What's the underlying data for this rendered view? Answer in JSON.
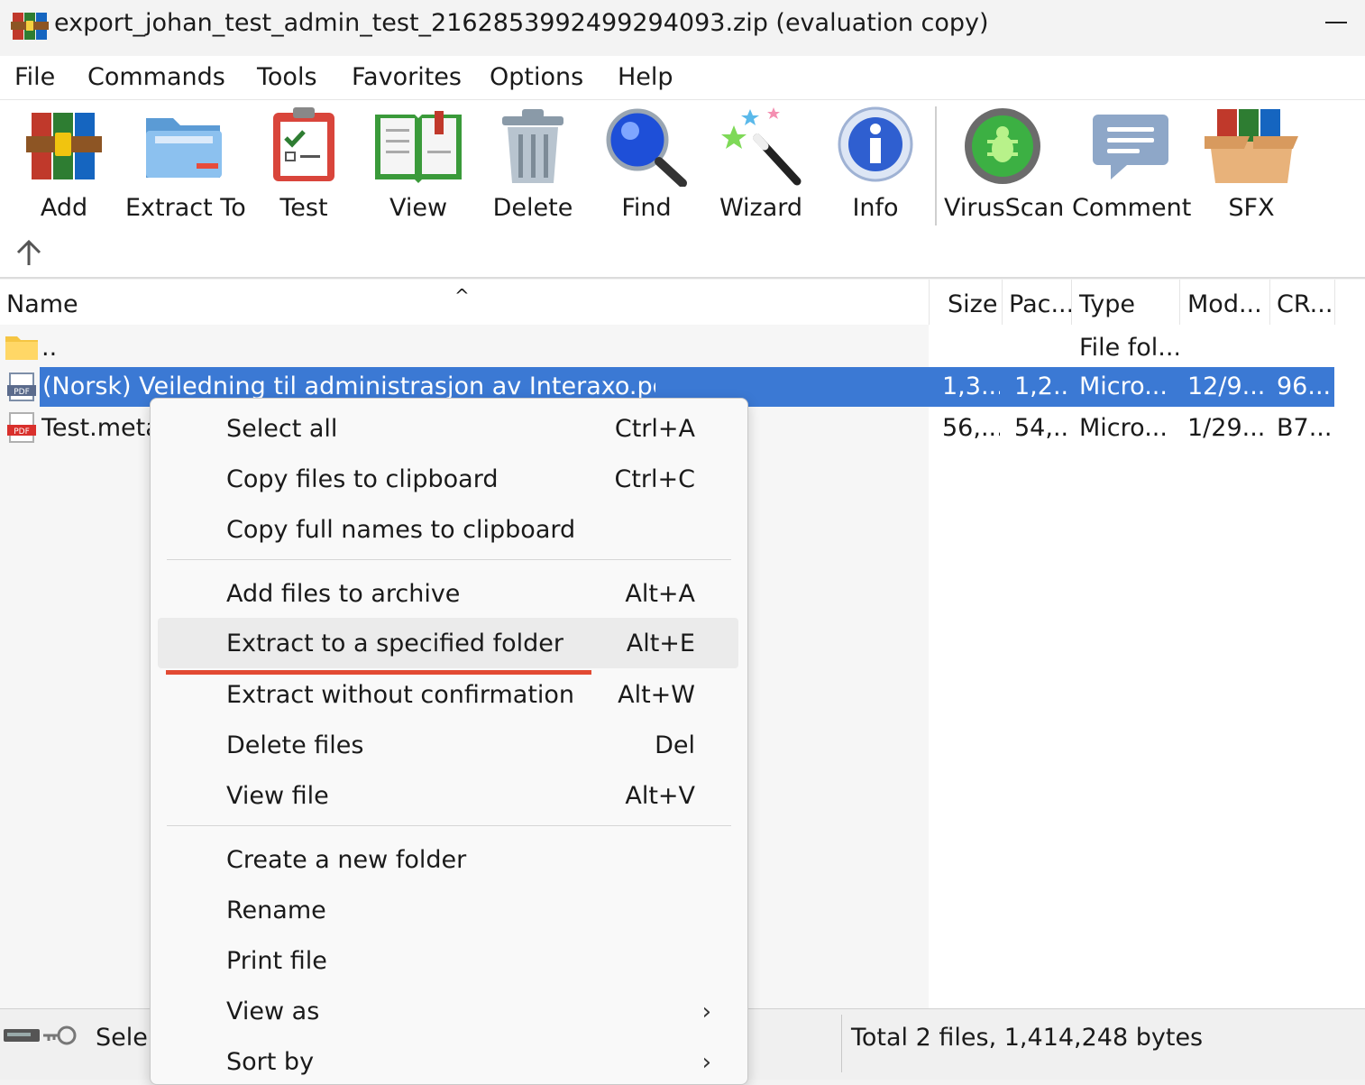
{
  "window": {
    "title": "export_johan_test_admin_test_2162853992499294093.zip (evaluation copy)"
  },
  "menu": [
    "File",
    "Commands",
    "Tools",
    "Favorites",
    "Options",
    "Help"
  ],
  "toolbar": {
    "add": "Add",
    "extract_to": "Extract To",
    "test": "Test",
    "view": "View",
    "delete": "Delete",
    "find": "Find",
    "wizard": "Wizard",
    "info": "Info",
    "virusscan": "VirusScan",
    "comment": "Comment",
    "sfx": "SFX"
  },
  "columns": {
    "name": "Name",
    "size": "Size",
    "packed": "Pac...",
    "type": "Type",
    "modified": "Mod...",
    "crc": "CR..."
  },
  "rows": [
    {
      "name": "..",
      "size": "",
      "packed": "",
      "type": "File fol...",
      "modified": "",
      "crc": ""
    },
    {
      "name": "(Norsk) Veiledning til administrasjon av Interaxo.pdf",
      "size": "1,3...",
      "packed": "1,2...",
      "type": "Micro...",
      "modified": "12/9...",
      "crc": "96..."
    },
    {
      "name": "Test.meta",
      "size": "56,...",
      "packed": "54,...",
      "type": "Micro...",
      "modified": "1/29...",
      "crc": "B7..."
    }
  ],
  "status": {
    "left": "Sele",
    "right": "Total 2 files, 1,414,248 bytes"
  },
  "context_menu": {
    "select_all": {
      "label": "Select all",
      "shortcut": "Ctrl+A"
    },
    "copy_files": {
      "label": "Copy files to clipboard",
      "shortcut": "Ctrl+C"
    },
    "copy_names": {
      "label": "Copy full names to clipboard"
    },
    "add_files": {
      "label": "Add files to archive",
      "shortcut": "Alt+A"
    },
    "extract_folder": {
      "label": "Extract to a specified folder",
      "shortcut": "Alt+E"
    },
    "extract_noconfirm": {
      "label": "Extract without confirmation",
      "shortcut": "Alt+W"
    },
    "delete_files": {
      "label": "Delete files",
      "shortcut": "Del"
    },
    "view_file": {
      "label": "View file",
      "shortcut": "Alt+V"
    },
    "new_folder": {
      "label": "Create a new folder"
    },
    "rename": {
      "label": "Rename"
    },
    "print_file": {
      "label": "Print file"
    },
    "view_as": {
      "label": "View as"
    },
    "sort_by": {
      "label": "Sort by"
    }
  },
  "colors": {
    "selection": "#3b79d4",
    "highlight_underline": "#e24a33"
  }
}
